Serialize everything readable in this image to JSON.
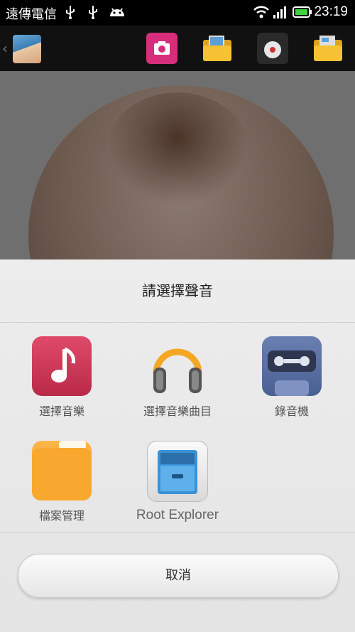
{
  "status_bar": {
    "carrier": "遠傳電信",
    "time": "23:19",
    "icons": [
      "usb-icon",
      "usb-icon",
      "android-icon",
      "wifi-icon",
      "signal-icon",
      "battery-icon"
    ]
  },
  "toolbar": {
    "icons": [
      "avatar",
      "camera-icon",
      "folder-image-icon",
      "record-icon",
      "folder-file-icon"
    ]
  },
  "dialog": {
    "title": "請選擇聲音",
    "apps": [
      {
        "label": "選擇音樂",
        "icon": "music-note-icon",
        "color": "#cf3556"
      },
      {
        "label": "選擇音樂曲目",
        "icon": "headphones-icon",
        "color": "#f5a623"
      },
      {
        "label": "錄音機",
        "icon": "cassette-icon",
        "color": "#556a9c"
      },
      {
        "label": "檔案管理",
        "icon": "folder-icon",
        "color": "#f7a030"
      },
      {
        "label": "Root Explorer",
        "icon": "file-cabinet-icon",
        "color": "#3a92d6"
      }
    ],
    "cancel_label": "取消"
  }
}
